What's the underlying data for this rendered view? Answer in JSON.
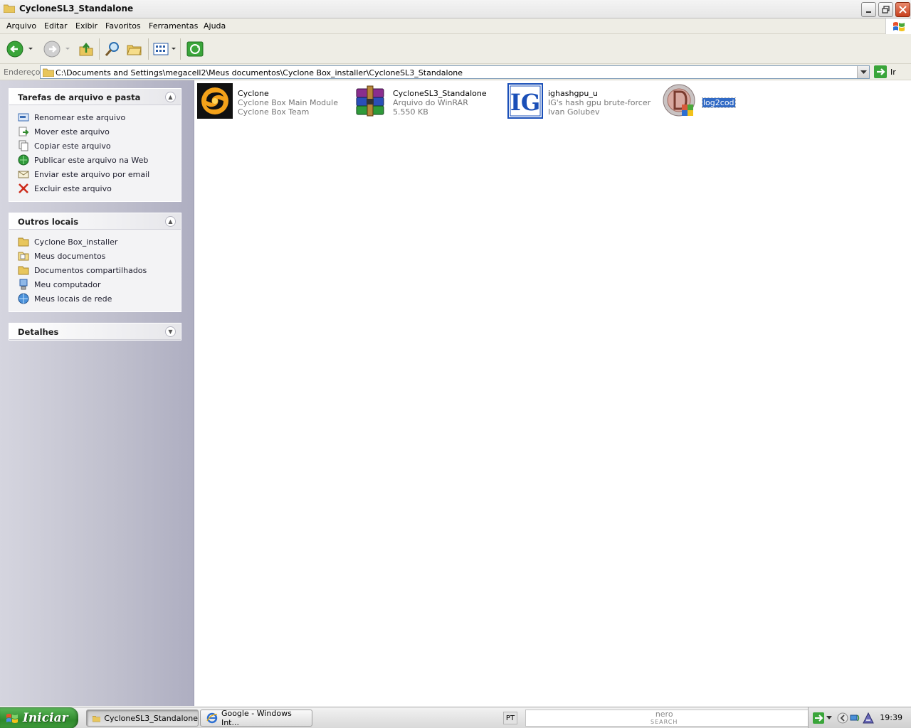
{
  "window": {
    "title": "CycloneSL3_Standalone"
  },
  "menu": [
    "Arquivo",
    "Editar",
    "Exibir",
    "Favoritos",
    "Ferramentas",
    "Ajuda"
  ],
  "address": {
    "label": "Endereço",
    "path": "C:\\Documents and Settings\\megacell2\\Meus documentos\\Cyclone Box_installer\\CycloneSL3_Standalone",
    "go_label": "Ir"
  },
  "tasks_panel": {
    "title": "Tarefas de arquivo e pasta",
    "items": [
      {
        "label": "Renomear este arquivo",
        "icon": "rename-icon"
      },
      {
        "label": "Mover este arquivo",
        "icon": "move-icon"
      },
      {
        "label": "Copiar este arquivo",
        "icon": "copy-icon"
      },
      {
        "label": "Publicar este arquivo na Web",
        "icon": "publish-web-icon"
      },
      {
        "label": "Enviar este arquivo por email",
        "icon": "email-icon"
      },
      {
        "label": "Excluir este arquivo",
        "icon": "delete-icon"
      }
    ]
  },
  "places_panel": {
    "title": "Outros locais",
    "items": [
      {
        "label": "Cyclone Box_installer",
        "icon": "folder-icon"
      },
      {
        "label": "Meus documentos",
        "icon": "my-documents-icon"
      },
      {
        "label": "Documentos compartilhados",
        "icon": "shared-folder-icon"
      },
      {
        "label": "Meu computador",
        "icon": "computer-icon"
      },
      {
        "label": "Meus locais de rede",
        "icon": "network-icon"
      }
    ]
  },
  "details_panel": {
    "title": "Detalhes"
  },
  "files": [
    {
      "name": "Cyclone",
      "line2": "Cyclone Box Main Module",
      "line3": "Cyclone Box Team",
      "icon": "cyclone-app-icon"
    },
    {
      "name": "CycloneSL3_Standalone",
      "line2": "Arquivo do WinRAR",
      "line3": "5.550 KB",
      "icon": "winrar-archive-icon"
    },
    {
      "name": "ighashgpu_u",
      "line2": "IG's hash gpu brute-forcer",
      "line3": "Ivan Golubev",
      "icon": "ig-app-icon"
    },
    {
      "name": "log2cod",
      "line2": "",
      "line3": "",
      "icon": "log2cod-icon",
      "selected": true
    }
  ],
  "taskbar": {
    "start_label": "Iniciar",
    "buttons": [
      {
        "label": "CycloneSL3_Standalone",
        "active": true
      },
      {
        "label": "Google - Windows Int...",
        "active": false
      }
    ],
    "language": "PT",
    "search_brand": "nero",
    "search_sub": "SEARCH",
    "clock": "19:39"
  },
  "colors": {
    "selection": "#316ac5",
    "start_green": "#3f9a3b",
    "close_red": "#c8401f"
  }
}
